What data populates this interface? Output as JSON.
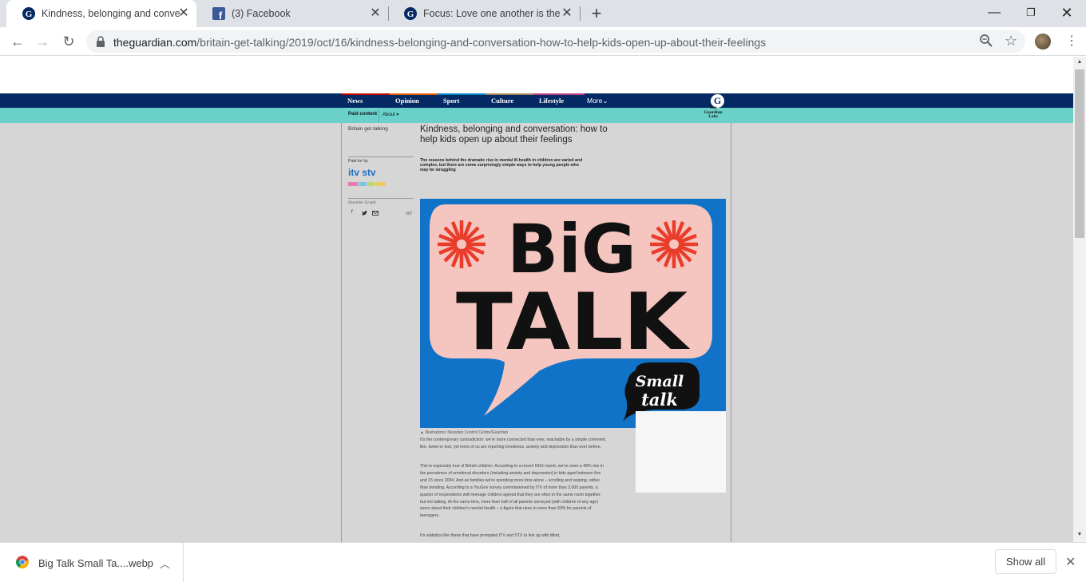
{
  "browser": {
    "tabs": [
      {
        "title": "Kindness, belonging and convers",
        "icon": "guardian-icon",
        "active": true
      },
      {
        "title": "(3) Facebook",
        "icon": "facebook-icon",
        "active": false
      },
      {
        "title": "Focus: Love one another is the fir",
        "icon": "guardian-icon",
        "active": false
      }
    ],
    "new_tab": "+",
    "url_host": "theguardian.com",
    "url_path": "/britain-get-talking/2019/oct/16/kindness-belonging-and-conversation-how-to-help-kids-open-up-about-their-feelings"
  },
  "site": {
    "nav": [
      {
        "label": "News",
        "color": "#c70000"
      },
      {
        "label": "Opinion",
        "color": "#e05e00"
      },
      {
        "label": "Sport",
        "color": "#0084c6"
      },
      {
        "label": "Culture",
        "color": "#a1845c"
      },
      {
        "label": "Lifestyle",
        "color": "#bb3b80"
      },
      {
        "label": "More",
        "color": ""
      }
    ],
    "more_chevron": "⌄",
    "logo_letter": "G",
    "paid_content": "Paid content",
    "about": "About ▾",
    "labs_logo": [
      "The",
      "Guardian",
      "Labs"
    ]
  },
  "article": {
    "series": "Britain get talking",
    "headline": "Kindness, belonging and conversation: how to help kids open up about their feelings",
    "standfirst": "The reasons behind the dramatic rise in mental ill-health in children are varied and complex, but there are some surprisingly simple ways to help young people who may be struggling",
    "paid_for_by": "Paid for by",
    "sponsor": "itv stv",
    "byline": "Danielle Graph",
    "share_count": "307",
    "hero_text": {
      "line1": "BiG",
      "line2": "TALK",
      "bubble1": "Small",
      "bubble2": "talk"
    },
    "caption": "▲ Illustrations: Neasden Control Centre/Guardian",
    "paragraphs": [
      "It's the contemporary contradiction: we're more connected than ever, reachable by a simple comment, like, tweet or text, yet more of us are reporting loneliness, anxiety and depression than ever before.",
      "This is especially true of British children. According to a recent NHS report, we've seen a 48% rise in the prevalence of emotional disorders (including anxiety and depression) in kids aged between five and 15 since 2004. And as families we're spending more time alone – scrolling and swiping, rather than bonding. According to a YouGov survey commissioned by ITV of more than 3,000 parents, a quarter of respondents with teenage children agreed that they are often in the same room together, but not talking. At the same time, more than half of all parents surveyed (with children of any age) worry about their children's mental health – a figure that rises to more than 60% for parents of teenagers.",
      "It's statistics like these that have prompted ITV and STV to link up with Mind,"
    ]
  },
  "downloads": {
    "file_name": "Big Talk Small Ta....webp",
    "show_all": "Show all"
  }
}
